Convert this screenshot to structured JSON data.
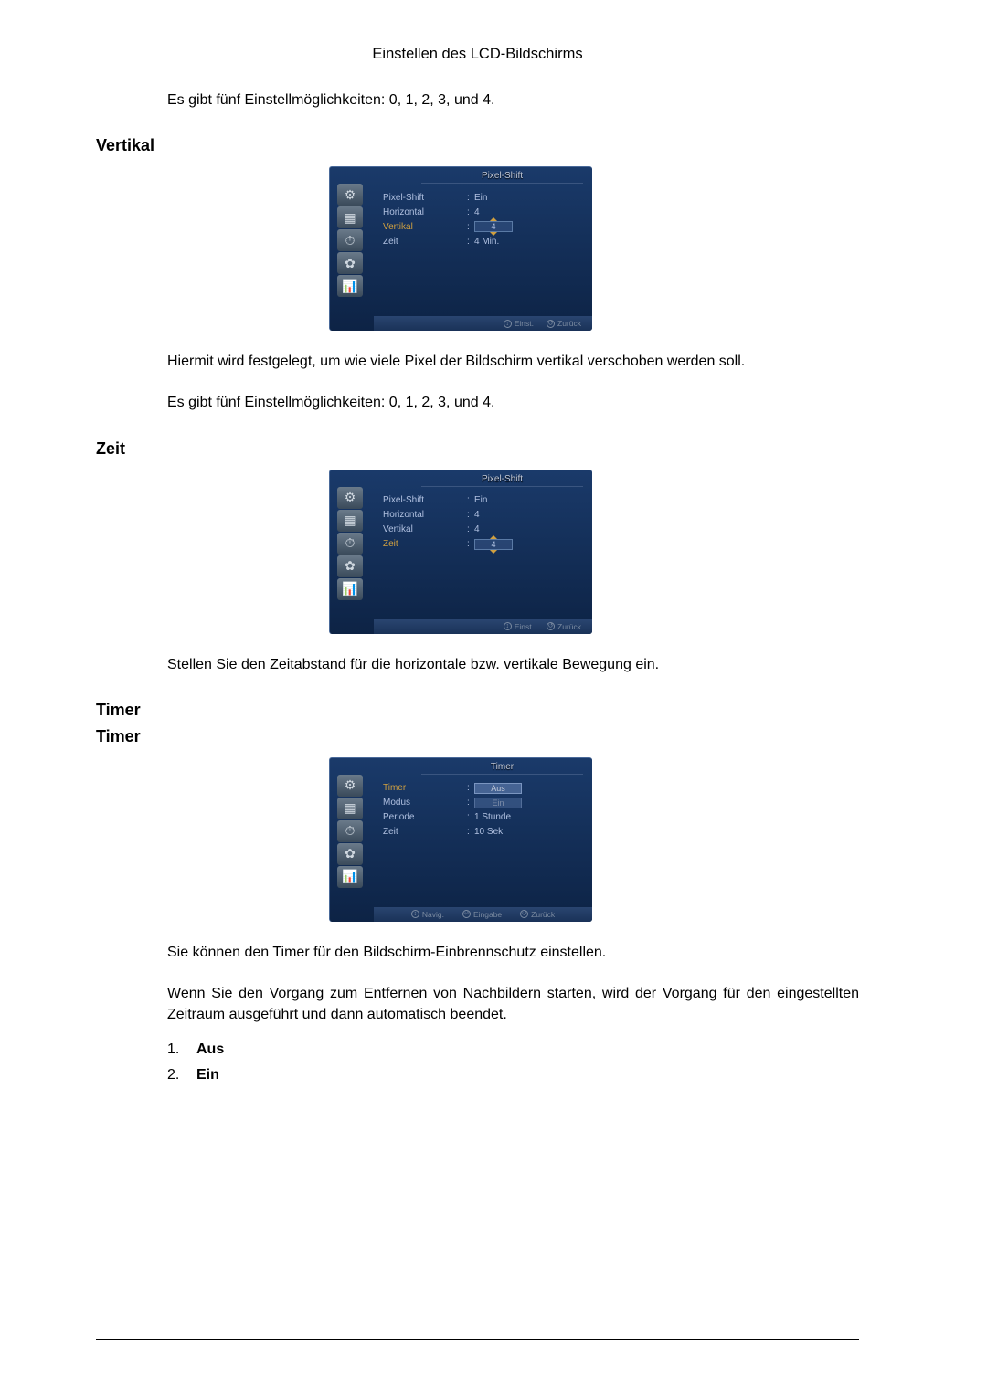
{
  "page": {
    "header": "Einstellen des LCD-Bildschirms",
    "intro_text": "Es gibt fünf Einstellmöglichkeiten: 0, 1, 2, 3, und 4."
  },
  "sections": {
    "vertikal": {
      "heading": "Vertikal",
      "osd": {
        "title": "Pixel-Shift",
        "rows": [
          {
            "label": "Pixel-Shift",
            "value": "Ein"
          },
          {
            "label": "Horizontal",
            "value": "4"
          },
          {
            "label": "Vertikal",
            "spinner": "4",
            "highlight": true
          },
          {
            "label": "Zeit",
            "value": "4 Min."
          }
        ],
        "footer": [
          "Einst.",
          "Zurück"
        ]
      },
      "para1": "Hiermit wird festgelegt, um wie viele Pixel der Bildschirm vertikal verschoben werden soll.",
      "para2": "Es gibt fünf Einstellmöglichkeiten: 0, 1, 2, 3, und 4."
    },
    "zeit": {
      "heading": "Zeit",
      "osd": {
        "title": "Pixel-Shift",
        "rows": [
          {
            "label": "Pixel-Shift",
            "value": "Ein"
          },
          {
            "label": "Horizontal",
            "value": "4"
          },
          {
            "label": "Vertikal",
            "value": "4"
          },
          {
            "label": "Zeit",
            "spinner": "4",
            "highlight": true
          }
        ],
        "footer": [
          "Einst.",
          "Zurück"
        ]
      },
      "para1": "Stellen Sie den Zeitabstand für die horizontale bzw. vertikale Bewegung ein."
    },
    "timer_h1": {
      "heading": "Timer"
    },
    "timer": {
      "heading": "Timer",
      "osd": {
        "title": "Timer",
        "rows": [
          {
            "label": "Timer",
            "select": "Aus",
            "select2": "Ein",
            "highlight": true
          },
          {
            "label": "Modus",
            "value": ""
          },
          {
            "label": "Periode",
            "value": "1 Stunde"
          },
          {
            "label": "Zeit",
            "value": "10 Sek."
          }
        ],
        "footer": [
          "Navig.",
          "Eingabe",
          "Zurück"
        ]
      },
      "para1": "Sie können den Timer für den Bildschirm-Einbrennschutz einstellen.",
      "para2": "Wenn Sie den Vorgang zum Entfernen von Nachbildern starten, wird der Vorgang für den eingestellten Zeitraum ausgeführt und dann automatisch beendet.",
      "list": [
        "Aus",
        "Ein"
      ]
    }
  },
  "osd_icons": [
    "⚙",
    "▦",
    "⏱",
    "✿",
    "📊"
  ]
}
